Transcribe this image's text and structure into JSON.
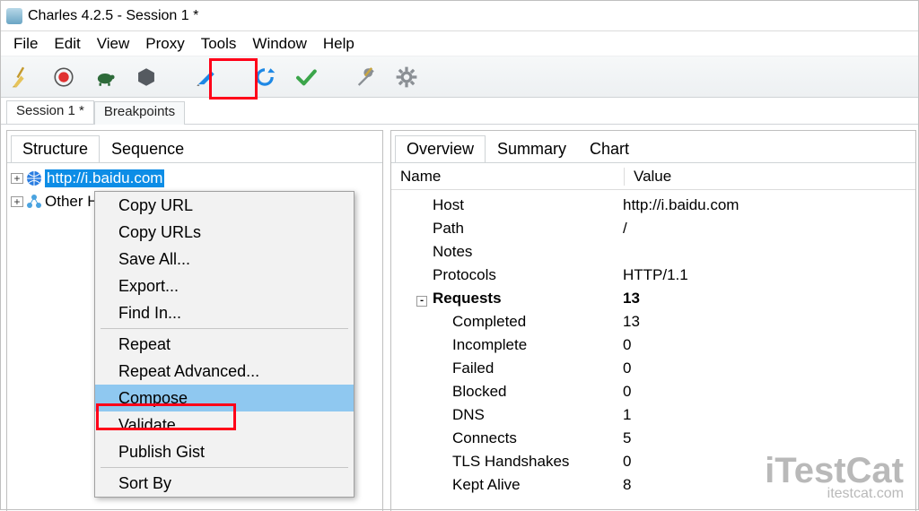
{
  "window": {
    "title": "Charles 4.2.5 - Session 1 *"
  },
  "menu": [
    "File",
    "Edit",
    "View",
    "Proxy",
    "Tools",
    "Window",
    "Help"
  ],
  "toolbar": [
    "broom",
    "record",
    "turtle",
    "hexagon",
    "pen",
    "refresh",
    "check",
    "wrench",
    "gear"
  ],
  "session_tabs": [
    "Session 1 *",
    "Breakpoints"
  ],
  "left_tabs": [
    "Structure",
    "Sequence"
  ],
  "tree": [
    {
      "text": "http://i.baidu.com",
      "icon": "globe",
      "selected": true
    },
    {
      "text": "Other Hosts",
      "icon": "cluster",
      "selected": false
    }
  ],
  "right_tabs": [
    "Overview",
    "Summary",
    "Chart"
  ],
  "ov_header": {
    "name": "Name",
    "value": "Value"
  },
  "overview": [
    {
      "k": "Host",
      "v": "http://i.baidu.com",
      "indent": 1
    },
    {
      "k": "Path",
      "v": "/",
      "indent": 1
    },
    {
      "k": "Notes",
      "v": "",
      "indent": 1
    },
    {
      "k": "Protocols",
      "v": "HTTP/1.1",
      "indent": 1
    },
    {
      "k": "Requests",
      "v": "13",
      "indent": 1,
      "bold": true,
      "collapse": true
    },
    {
      "k": "Completed",
      "v": "13",
      "indent": 2
    },
    {
      "k": "Incomplete",
      "v": "0",
      "indent": 2
    },
    {
      "k": "Failed",
      "v": "0",
      "indent": 2
    },
    {
      "k": "Blocked",
      "v": "0",
      "indent": 2
    },
    {
      "k": "DNS",
      "v": "1",
      "indent": 2
    },
    {
      "k": "Connects",
      "v": "5",
      "indent": 2
    },
    {
      "k": "TLS Handshakes",
      "v": "0",
      "indent": 2
    },
    {
      "k": "Kept Alive",
      "v": "8",
      "indent": 2
    }
  ],
  "context_menu": [
    {
      "label": "Copy URL"
    },
    {
      "label": "Copy URLs"
    },
    {
      "label": "Save All..."
    },
    {
      "label": "Export..."
    },
    {
      "label": "Find In..."
    },
    {
      "sep": true
    },
    {
      "label": "Repeat"
    },
    {
      "label": "Repeat Advanced..."
    },
    {
      "label": "Compose",
      "hover": true
    },
    {
      "label": "Validate"
    },
    {
      "label": "Publish Gist"
    },
    {
      "sep": true
    },
    {
      "label": "Sort By"
    }
  ],
  "watermark": {
    "big": "iTestCat",
    "small": "itestcat.com"
  }
}
